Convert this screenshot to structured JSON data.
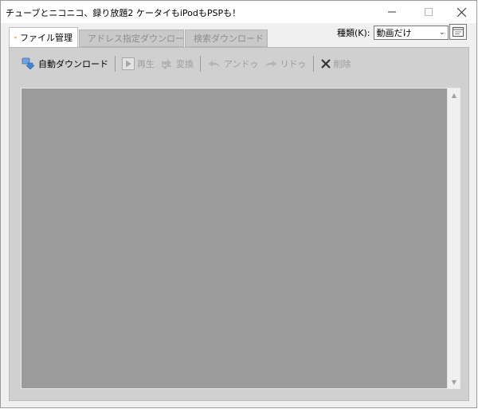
{
  "window": {
    "title": "チューブとニコニコ、録り放題2 ケータイもiPodもPSPも！"
  },
  "tabs": [
    {
      "label": "ファイル管理",
      "icon": "folder-icon",
      "active": true
    },
    {
      "label": "アドレス指定ダウンロード",
      "icon": "url-icon",
      "active": false
    },
    {
      "label": "検索ダウンロード",
      "icon": "magnifier-icon",
      "active": false
    }
  ],
  "kind": {
    "label": "種類(K):",
    "selected": "動画だけ"
  },
  "toolbar": {
    "auto_download": "自動ダウンロード",
    "play": "再生",
    "convert": "変換",
    "undo": "アンドゥ",
    "redo": "リドゥ",
    "delete": "削除"
  },
  "colors": {
    "list_background": "#9b9b9b",
    "frame_background": "#d0d0d0",
    "disabled_text": "#9c9c9c"
  }
}
